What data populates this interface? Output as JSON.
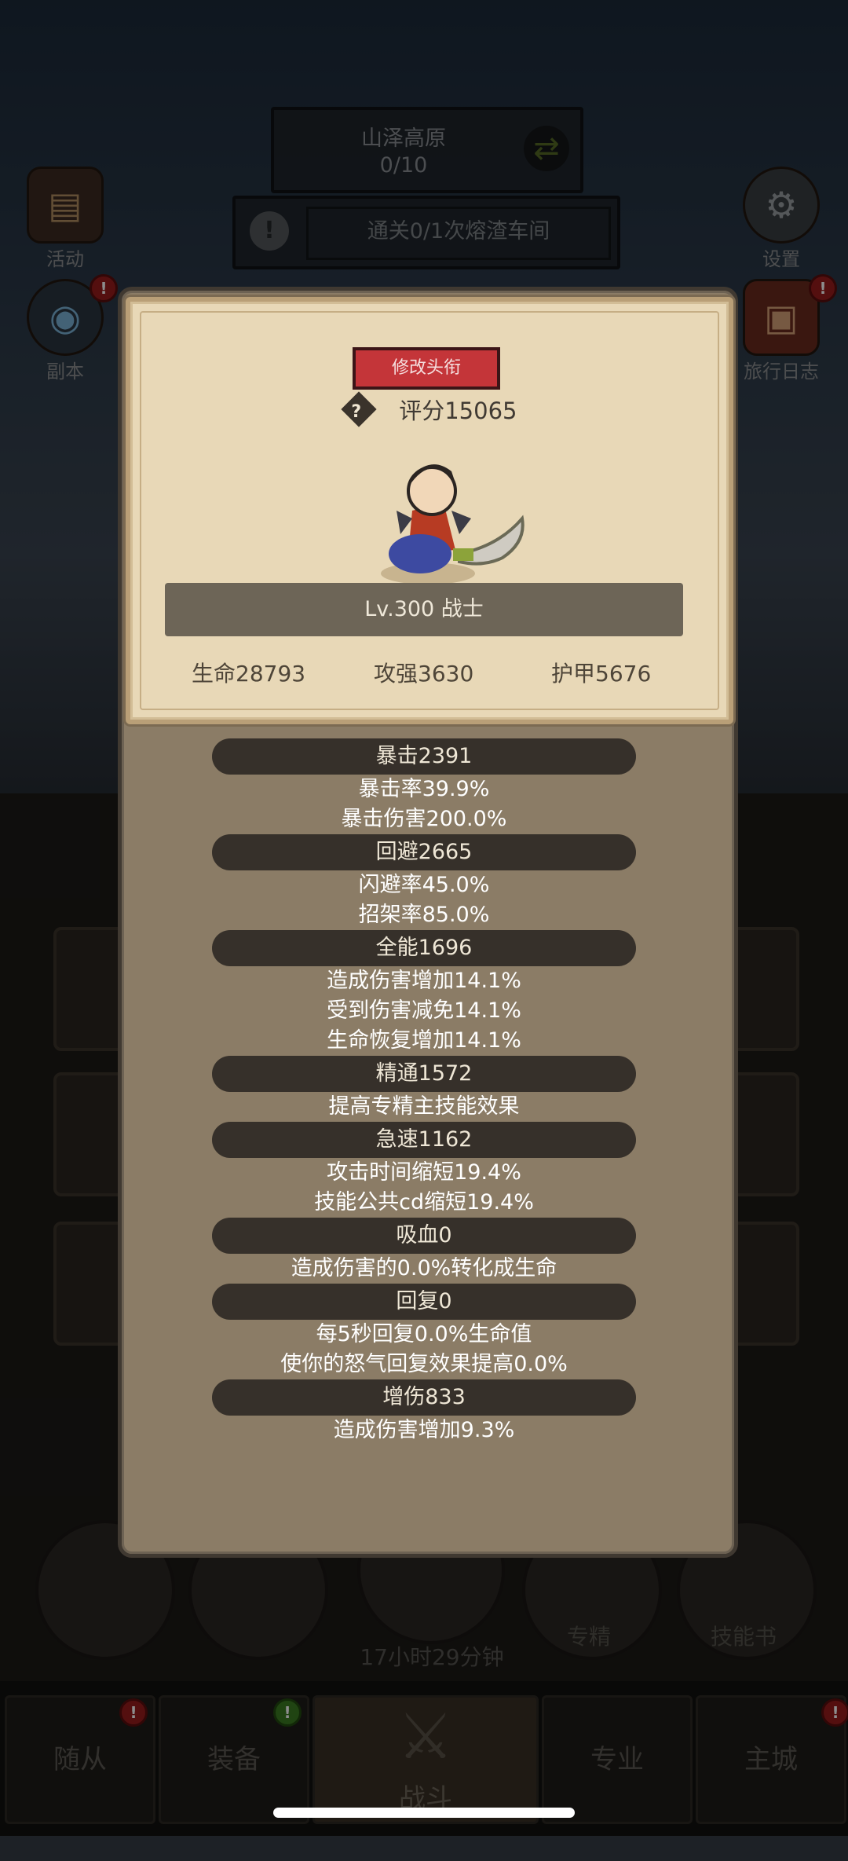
{
  "hud": {
    "location_name": "山泽高原",
    "location_progress": "0/10",
    "quest_text": "通关0/1次熔渣车间",
    "left_icons": [
      {
        "label": "活动"
      },
      {
        "label": "副本"
      }
    ],
    "right_icons": [
      {
        "label": "设置"
      },
      {
        "label": "旅行日志"
      }
    ]
  },
  "panel": {
    "title_button": "修改头衔",
    "score": "评分15065",
    "level_class": "Lv.300 战士",
    "base_stats": {
      "hp": "生命28793",
      "attack": "攻强3630",
      "armor": "护甲5676"
    },
    "stats": [
      {
        "header": "暴击2391",
        "lines": [
          "暴击率39.9%",
          "暴击伤害200.0%"
        ]
      },
      {
        "header": "回避2665",
        "lines": [
          "闪避率45.0%",
          "招架率85.0%"
        ]
      },
      {
        "header": "全能1696",
        "lines": [
          "造成伤害增加14.1%",
          "受到伤害减免14.1%",
          "生命恢复增加14.1%"
        ]
      },
      {
        "header": "精通1572",
        "lines": [
          "提高专精主技能效果"
        ]
      },
      {
        "header": "急速1162",
        "lines": [
          "攻击时间缩短19.4%",
          "技能公共cd缩短19.4%"
        ]
      },
      {
        "header": "吸血0",
        "lines": [
          "造成伤害的0.0%转化成生命"
        ]
      },
      {
        "header": "回复0",
        "lines": [
          "每5秒回复0.0%生命值",
          "使你的怒气回复效果提高0.0%"
        ]
      },
      {
        "header": "增伤833",
        "lines": [
          "造成伤害增加9.3%"
        ]
      }
    ]
  },
  "background": {
    "timer": "17小时29分钟",
    "round_labels": [
      "专精",
      "技能书"
    ]
  },
  "bottom_nav": {
    "tabs": [
      "随从",
      "装备",
      "战斗",
      "专业",
      "主城"
    ]
  },
  "colors": {
    "title_button": "#c43539",
    "panel": "#8b7c66",
    "card": "#e8d8b7",
    "stat_header": "#36302a"
  }
}
